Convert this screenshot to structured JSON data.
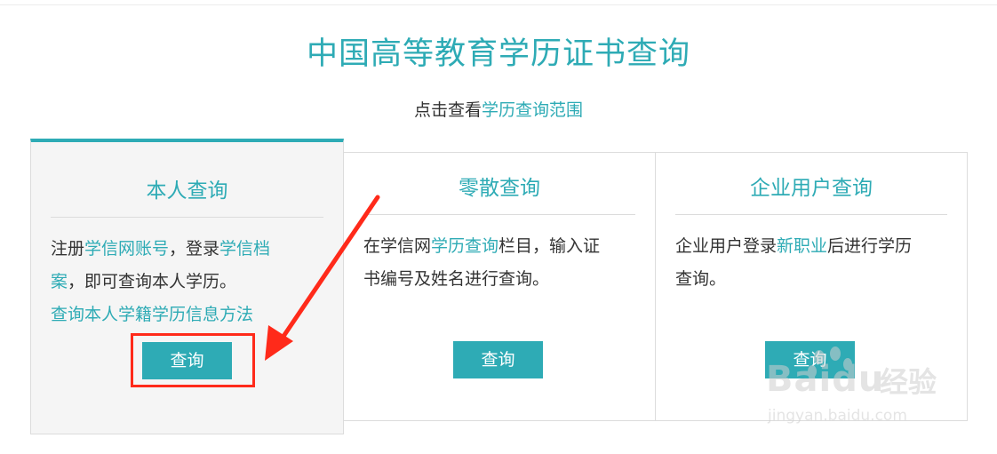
{
  "header": {
    "title": "中国高等教育学历证书查询",
    "subtitle_prefix": "点击查看",
    "subtitle_link": "学历查询范围"
  },
  "cards": [
    {
      "title": "本人查询",
      "desc_1": "注册",
      "link_1": "学信网账号",
      "desc_2": "，登录",
      "link_2": "学信档",
      "link_2b": "案",
      "desc_3": "，即可查询本人学历。",
      "method_link": "查询本人学籍学历信息方法",
      "button": "查询"
    },
    {
      "title": "零散查询",
      "desc_1": "在学信网",
      "link_1": "学历查询",
      "desc_2": "栏目，输入证",
      "desc_3": "书编号及姓名进行查询。",
      "button": "查询"
    },
    {
      "title": "企业用户查询",
      "desc_1": "企业用户登录",
      "link_1": "新职业",
      "desc_2": "后进行学历",
      "desc_3": "查询。",
      "button": "查询"
    }
  ],
  "watermark": {
    "logo": "Baidu",
    "suffix": "经验",
    "url": "jingyan.baidu.com"
  },
  "colors": {
    "accent": "#2eabb5",
    "annotation": "#ff2a1a",
    "text": "#333333"
  }
}
